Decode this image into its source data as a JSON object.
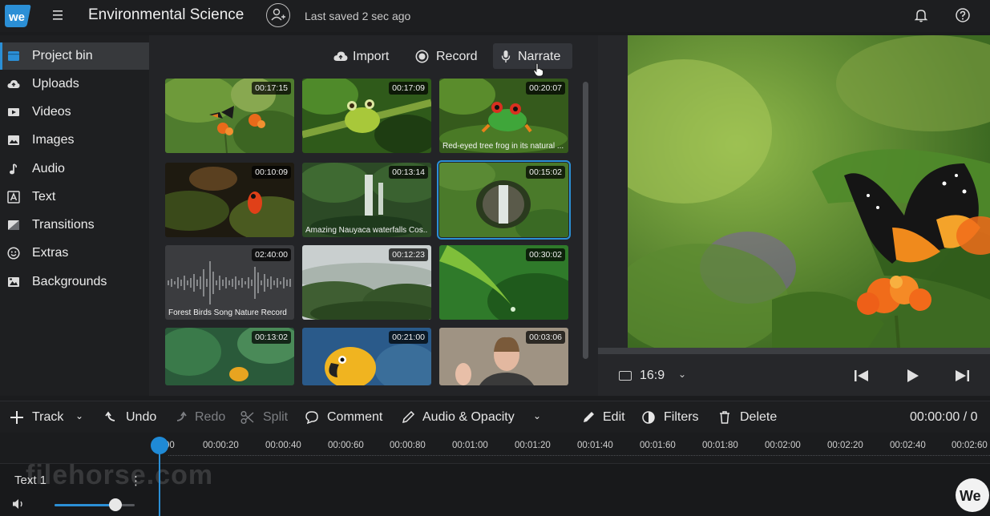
{
  "app": {
    "title": "Environmental Science",
    "save_status": "Last saved 2 sec ago",
    "logo_text": "we"
  },
  "sidebar": {
    "items": [
      {
        "label": "Project bin",
        "icon": "folder-icon"
      },
      {
        "label": "Uploads",
        "icon": "cloud-upload-icon"
      },
      {
        "label": "Videos",
        "icon": "video-icon"
      },
      {
        "label": "Images",
        "icon": "image-icon"
      },
      {
        "label": "Audio",
        "icon": "music-note-icon"
      },
      {
        "label": "Text",
        "icon": "text-icon"
      },
      {
        "label": "Transitions",
        "icon": "transition-icon"
      },
      {
        "label": "Extras",
        "icon": "smiley-icon"
      },
      {
        "label": "Backgrounds",
        "icon": "backgrounds-icon"
      }
    ],
    "active_index": 0
  },
  "bin": {
    "actions": {
      "import": "Import",
      "record": "Record",
      "narrate": "Narrate"
    },
    "clips": [
      {
        "duration": "00:17:15",
        "caption": ""
      },
      {
        "duration": "00:17:09",
        "caption": ""
      },
      {
        "duration": "00:20:07",
        "caption": "Red-eyed tree frog in its natural ..."
      },
      {
        "duration": "00:10:09",
        "caption": ""
      },
      {
        "duration": "00:13:14",
        "caption": "Amazing Nauyaca waterfalls Cos..."
      },
      {
        "duration": "00:15:02",
        "caption": "",
        "selected": true
      },
      {
        "duration": "02:40:00",
        "caption": "Forest Birds Song Nature Record"
      },
      {
        "duration": "00:12:23",
        "caption": ""
      },
      {
        "duration": "00:30:02",
        "caption": ""
      },
      {
        "duration": "00:13:02",
        "caption": ""
      },
      {
        "duration": "00:21:00",
        "caption": ""
      },
      {
        "duration": "00:03:06",
        "caption": ""
      }
    ]
  },
  "preview": {
    "aspect_ratio": "16:9"
  },
  "toolbar": {
    "track": "Track",
    "undo": "Undo",
    "redo": "Redo",
    "split": "Split",
    "comment": "Comment",
    "audio_opacity": "Audio & Opacity",
    "edit": "Edit",
    "filters": "Filters",
    "delete": "Delete",
    "timecode": "00:00:00 / 0"
  },
  "timeline": {
    "ticks": [
      "00",
      "00:00:20",
      "00:00:40",
      "00:00:60",
      "00:00:80",
      "00:01:00",
      "00:01:20",
      "00:01:40",
      "00:01:60",
      "00:01:80",
      "00:02:00",
      "00:02:20",
      "00:02:40",
      "00:02:60"
    ],
    "track_label": "Text 1",
    "track_menu": "⋮",
    "volume": 0.76
  },
  "watermark": "filehorse.com",
  "badge": "We"
}
